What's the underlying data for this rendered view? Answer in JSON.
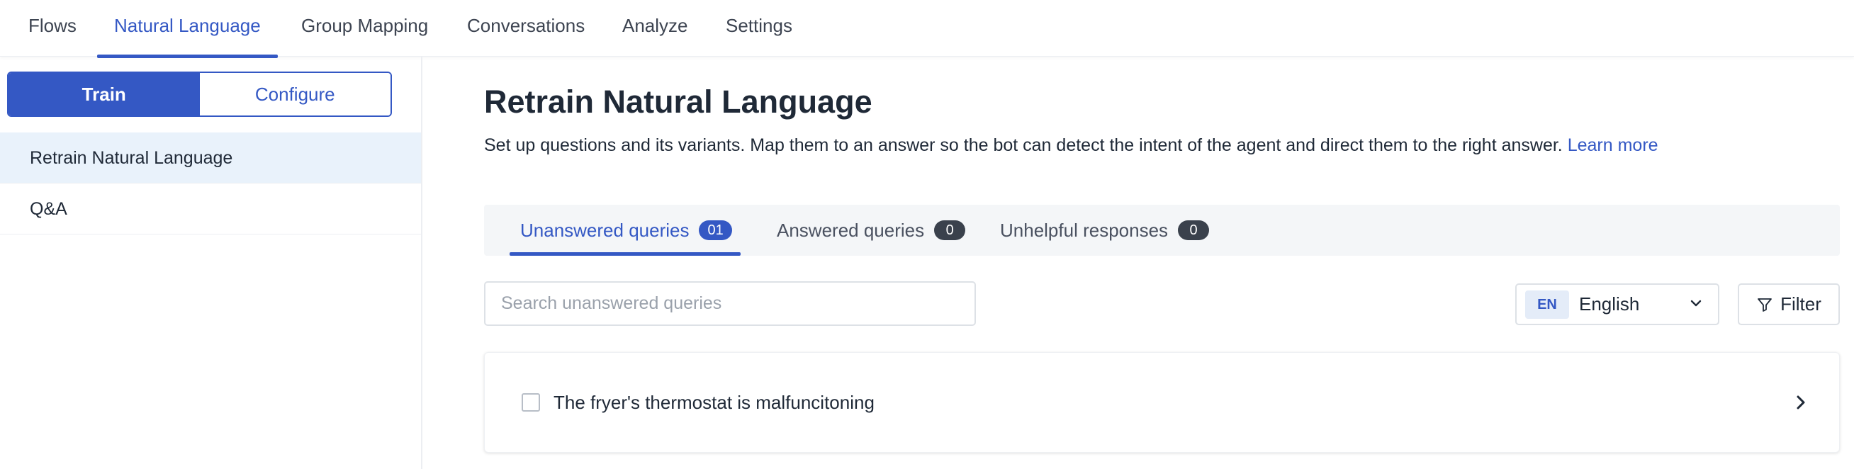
{
  "topnav": {
    "tabs": [
      {
        "label": "Flows"
      },
      {
        "label": "Natural Language"
      },
      {
        "label": "Group Mapping"
      },
      {
        "label": "Conversations"
      },
      {
        "label": "Analyze"
      },
      {
        "label": "Settings"
      }
    ],
    "active_tab": "Natural Language"
  },
  "sidebar": {
    "segment": {
      "train_label": "Train",
      "configure_label": "Configure",
      "selected": "Train"
    },
    "items": [
      {
        "label": "Retrain Natural Language",
        "selected": true
      },
      {
        "label": "Q&A",
        "selected": false
      }
    ]
  },
  "main": {
    "title": "Retrain Natural Language",
    "description": "Set up questions and its variants. Map them to an answer so the bot can detect the intent of the agent and direct them to the right answer.",
    "learn_more": "Learn more",
    "tabs": [
      {
        "label": "Unanswered queries",
        "count": "01",
        "active": true
      },
      {
        "label": "Answered queries",
        "count": "0",
        "active": false
      },
      {
        "label": "Unhelpful responses",
        "count": "0",
        "active": false
      }
    ],
    "search": {
      "placeholder": "Search unanswered queries",
      "value": ""
    },
    "language": {
      "code": "EN",
      "name": "English"
    },
    "filter_label": "Filter",
    "queries": [
      {
        "text": "The fryer's thermostat is malfuncitoning",
        "checked": false
      }
    ]
  },
  "colors": {
    "accent": "#3458c4",
    "selected_bg": "#e9f2fb",
    "badge_bg": "#3a414c",
    "tabs_bg": "#f4f6f8"
  }
}
